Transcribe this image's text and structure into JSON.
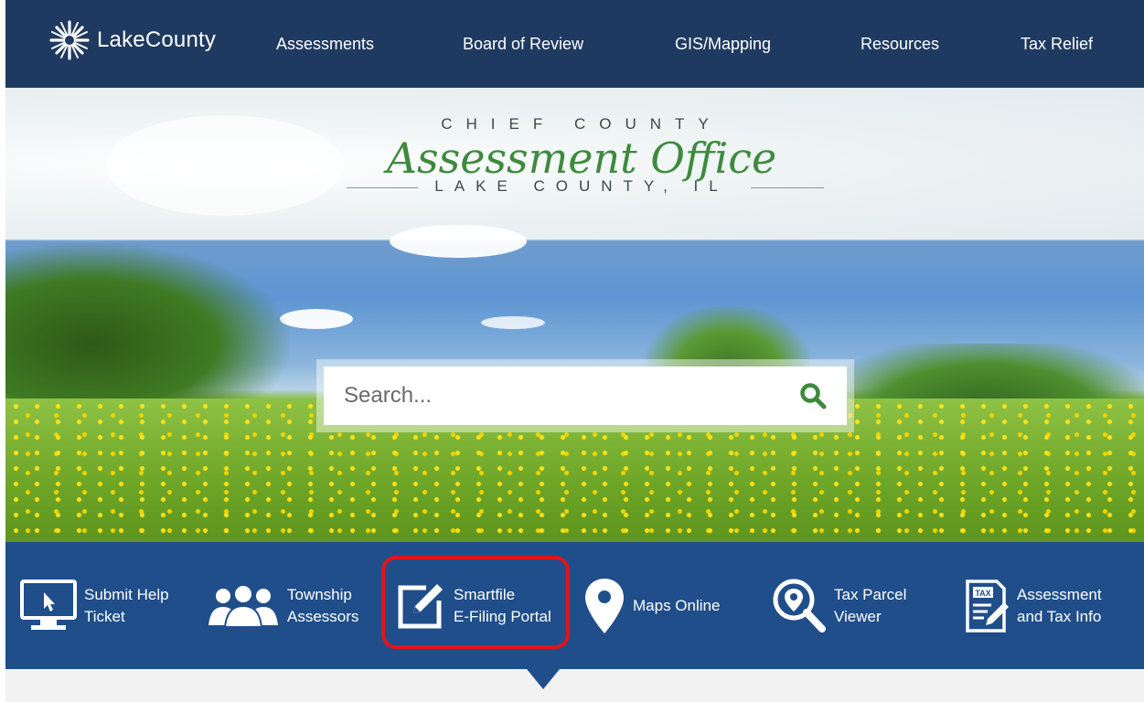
{
  "header": {
    "logo_text": "LakeCounty",
    "nav": [
      {
        "label": "Assessments"
      },
      {
        "label": "Board of Review"
      },
      {
        "label": "GIS/Mapping"
      },
      {
        "label": "Resources"
      },
      {
        "label": "Tax Relief"
      }
    ]
  },
  "hero": {
    "line1": "CHIEF COUNTY",
    "script": "Assessment Office",
    "line3": "LAKE COUNTY, IL"
  },
  "search": {
    "placeholder": "Search...",
    "icon": "search-icon"
  },
  "quick_links": [
    {
      "label": "Submit Help\nTicket",
      "icon": "monitor-cursor-icon"
    },
    {
      "label": "Township\nAssessors",
      "icon": "people-group-icon"
    },
    {
      "label": "Smartfile\nE-Filing Portal",
      "icon": "edit-square-icon",
      "highlighted": true
    },
    {
      "label": "Maps Online",
      "icon": "map-pin-icon"
    },
    {
      "label": "Tax Parcel\nViewer",
      "icon": "magnify-pin-icon"
    },
    {
      "label": "Assessment\nand Tax Info",
      "icon": "tax-document-icon"
    }
  ],
  "colors": {
    "nav_bg": "#1f3a60",
    "quickbar_bg": "#1f4e8a",
    "highlight": "#e2131c",
    "search_icon": "#3d8a3d"
  }
}
